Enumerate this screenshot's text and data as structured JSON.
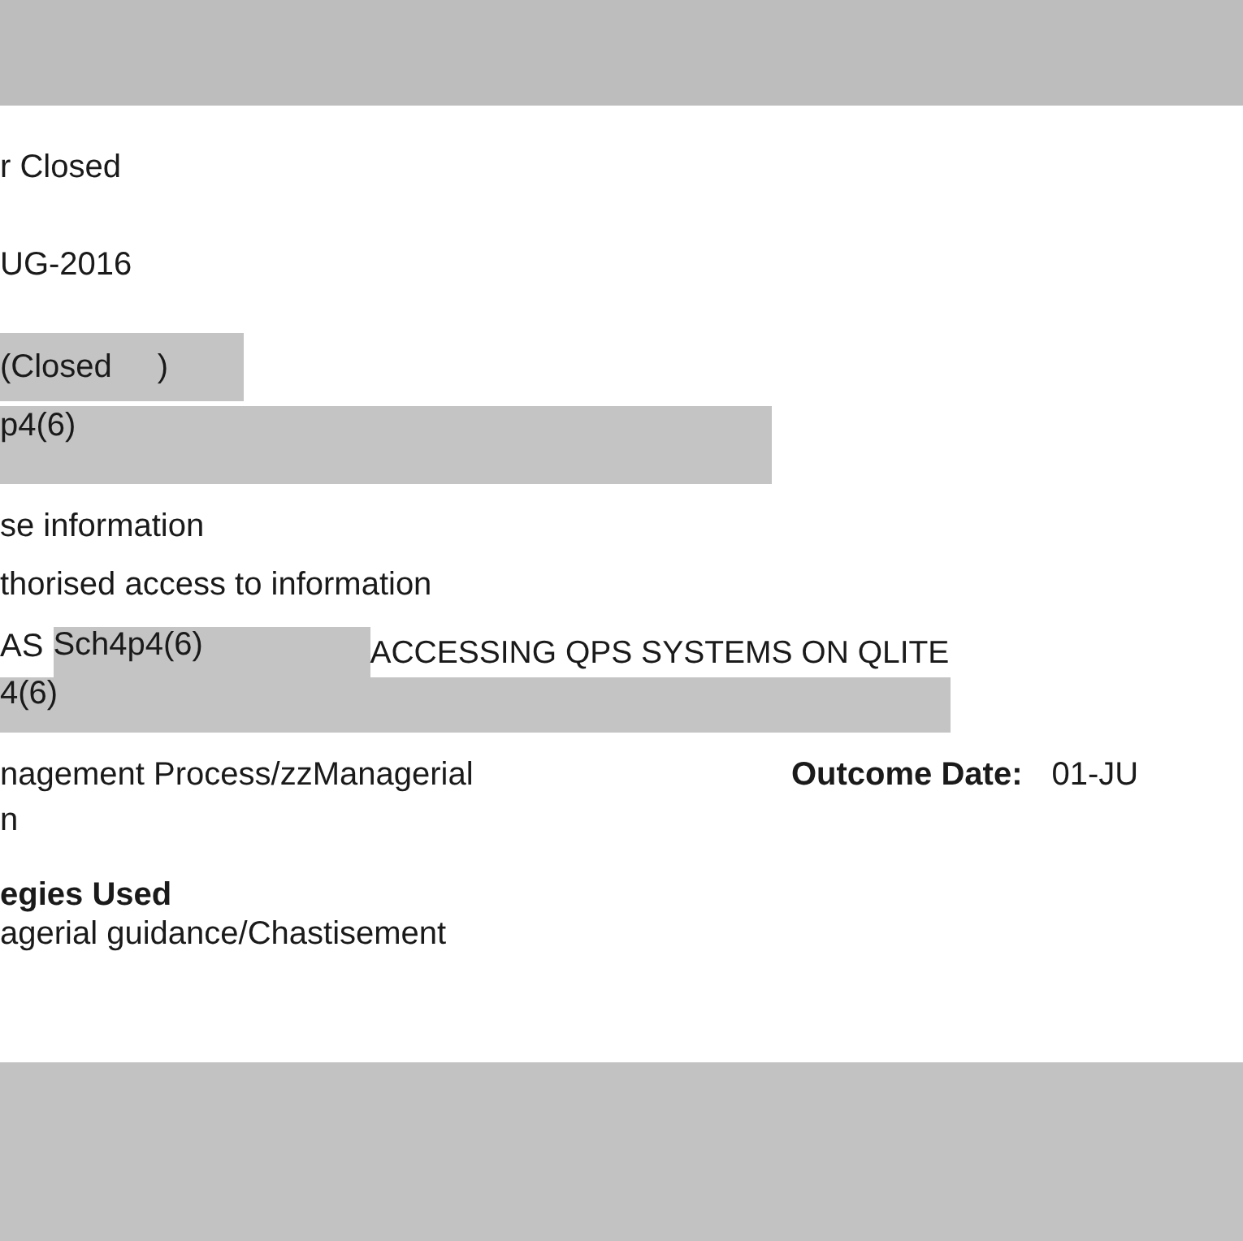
{
  "status_line": "r Closed",
  "date_line": "UG-2016",
  "status_redacted": {
    "left": "(Closed",
    "right": ")"
  },
  "redacted_line": "p4(6)",
  "category_lines": [
    "se information",
    "thorised access to information"
  ],
  "summary": {
    "prefix": "AS",
    "redacted": "Sch4p4(6)",
    "text": "ACCESSING QPS SYSTEMS ON QLITE"
  },
  "summary_redacted": "4(6)",
  "outcome": {
    "value_lines": [
      "nagement Process/zzManagerial",
      "n"
    ],
    "date_label": "Outcome Date:",
    "date_value": "01-JU"
  },
  "strategies": {
    "heading": "egies Used",
    "value": "agerial guidance/Chastisement"
  }
}
